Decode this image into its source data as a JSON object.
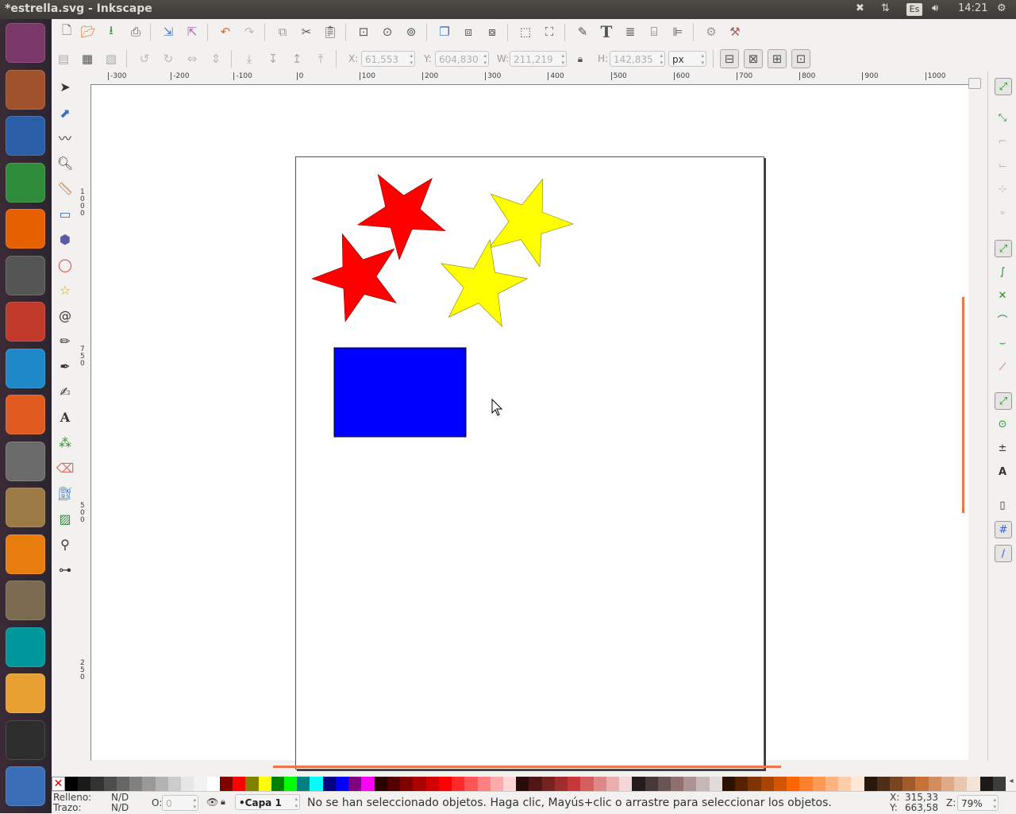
{
  "window": {
    "title": "*estrella.svg - Inkscape"
  },
  "system_tray": {
    "language": "Es",
    "time": "14:21"
  },
  "launcher": {
    "apps": [
      {
        "name": "ubuntu-dash-icon",
        "color": "#7a3868"
      },
      {
        "name": "files-icon",
        "color": "#a0522d"
      },
      {
        "name": "writer-icon",
        "color": "#2a5fa8"
      },
      {
        "name": "calc-icon",
        "color": "#2e8b3a"
      },
      {
        "name": "firefox-icon",
        "color": "#e66000"
      },
      {
        "name": "inkscape-icon",
        "color": "#555555"
      },
      {
        "name": "fritzing-icon",
        "color": "#c0392b"
      },
      {
        "name": "cmaptools-icon",
        "color": "#1e88c8"
      },
      {
        "name": "software-center-icon",
        "color": "#e05a20"
      },
      {
        "name": "system-settings-icon",
        "color": "#6b6b6b"
      },
      {
        "name": "archive-manager-icon",
        "color": "#9c7a46"
      },
      {
        "name": "blender-icon",
        "color": "#e87d0d"
      },
      {
        "name": "gimp-icon",
        "color": "#7a6a4f"
      },
      {
        "name": "arduino-icon",
        "color": "#00979c"
      },
      {
        "name": "scratch-icon",
        "color": "#e8a030"
      },
      {
        "name": "terminal-icon",
        "color": "#2d2d2d"
      },
      {
        "name": "workspaces-icon",
        "color": "#3a6fb8"
      }
    ]
  },
  "controls": {
    "x_label": "X:",
    "x_value": "61,553",
    "y_label": "Y:",
    "y_value": "604,830",
    "w_label": "W:",
    "w_value": "211,219",
    "h_label": "H:",
    "h_value": "142,835",
    "unit": "px"
  },
  "ruler_top": [
    "-300",
    "-200",
    "-100",
    "0",
    "100",
    "200",
    "300",
    "400",
    "500",
    "600",
    "700",
    "800",
    "900",
    "1000"
  ],
  "ruler_left": [
    "1\n0\n0\n0",
    "7\n5\n0",
    "5\n0\n0",
    "2\n5\n0"
  ],
  "palette": [
    "#000000",
    "#1a1a1a",
    "#333333",
    "#4d4d4d",
    "#666666",
    "#808080",
    "#999999",
    "#b3b3b3",
    "#cccccc",
    "#e6e6e6",
    "#f2f2f2",
    "#ffffff",
    "#800000",
    "#ff0000",
    "#808000",
    "#ffff00",
    "#008000",
    "#00ff00",
    "#008080",
    "#00ffff",
    "#000080",
    "#0000ff",
    "#800080",
    "#ff00ff",
    "#2b0000",
    "#550000",
    "#800000",
    "#aa0000",
    "#d40000",
    "#ff0000",
    "#ff2a2a",
    "#ff5555",
    "#ff8080",
    "#ffaaaa",
    "#ffd5d5",
    "#280b0b",
    "#501616",
    "#782121",
    "#a02c2c",
    "#c83737",
    "#d35f5f",
    "#de8787",
    "#e9afaf",
    "#f4d7d7",
    "#241c1c",
    "#483737",
    "#6c5353",
    "#916f6f",
    "#ac9393",
    "#c8b7b7",
    "#e3dbdb",
    "#2b1100",
    "#552200",
    "#803300",
    "#aa4400",
    "#d45500",
    "#ff6600",
    "#ff7f2a",
    "#ff9955",
    "#ffb380",
    "#ffccaa",
    "#ffe6d5",
    "#28170b",
    "#502d16",
    "#784421",
    "#a05a2c",
    "#c87137",
    "#d38d5f",
    "#deaa87",
    "#e9c6af",
    "#f4e3d7",
    "#1c1a16",
    "#3c3c3c"
  ],
  "status": {
    "fill_label": "Relleno:",
    "fill_value": "N/D",
    "stroke_label": "Trazo:",
    "stroke_value": "N/D",
    "opacity_label": "O:",
    "opacity_value": "0",
    "layer": "•Capa 1",
    "message": "No se han seleccionado objetos. Haga clic, Mayús+clic o arrastre para seleccionar los objetos.",
    "cursor_x_label": "X:",
    "cursor_x": "315,33",
    "cursor_y_label": "Y:",
    "cursor_y": "663,58",
    "zoom_label": "Z:",
    "zoom": "79%"
  },
  "drawing": {
    "shapes": [
      {
        "type": "star",
        "name": "red-star-1",
        "fill": "#ff0000"
      },
      {
        "type": "star",
        "name": "red-star-2",
        "fill": "#ff0000"
      },
      {
        "type": "star",
        "name": "yellow-star-1",
        "fill": "#ffff00"
      },
      {
        "type": "star",
        "name": "yellow-star-2",
        "fill": "#ffff00"
      },
      {
        "type": "rect",
        "name": "blue-rectangle",
        "fill": "#0000ff"
      }
    ]
  }
}
